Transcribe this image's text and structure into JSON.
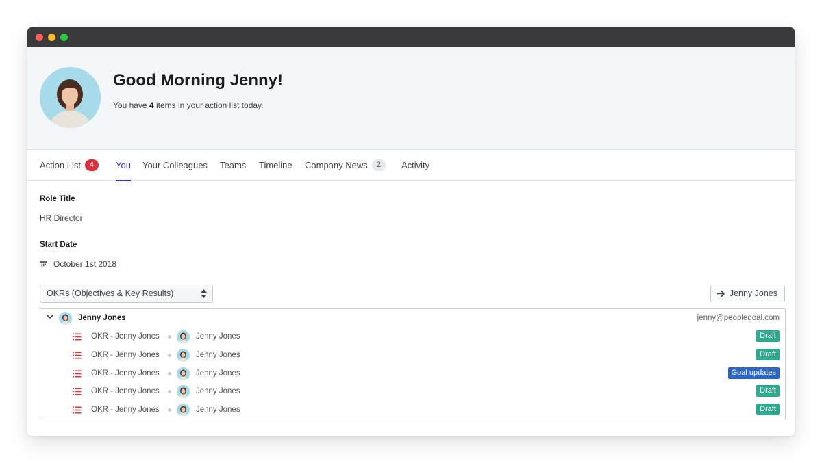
{
  "header": {
    "greeting": "Good Morning Jenny!",
    "subline_prefix": "You have ",
    "subline_count": "4",
    "subline_suffix": " items in your action list today."
  },
  "tabs": [
    {
      "label": "Action List",
      "badge": "4"
    },
    {
      "label": "You"
    },
    {
      "label": "Your Colleagues"
    },
    {
      "label": "Teams"
    },
    {
      "label": "Timeline"
    },
    {
      "label": "Company News",
      "badge": "2"
    },
    {
      "label": "Activity"
    }
  ],
  "active_tab": "You",
  "profile": {
    "role_title_label": "Role Title",
    "role_title_value": "HR Director",
    "start_date_label": "Start Date",
    "start_date_value": "October 1st 2018"
  },
  "view_select": {
    "selected": "OKRs (Objectives & Key Results)"
  },
  "user_button": {
    "label": "Jenny Jones",
    "icon": "arrow-right-icon"
  },
  "tree": {
    "owner_name": "Jenny Jones",
    "owner_email": "jenny@peoplegoal.com",
    "rows": [
      {
        "title": "OKR - Jenny Jones",
        "owner": "Jenny Jones",
        "status": "Draft"
      },
      {
        "title": "OKR - Jenny Jones",
        "owner": "Jenny Jones",
        "status": "Draft"
      },
      {
        "title": "OKR - Jenny Jones",
        "owner": "Jenny Jones",
        "status": "Goal updates"
      },
      {
        "title": "OKR - Jenny Jones",
        "owner": "Jenny Jones",
        "status": "Draft"
      },
      {
        "title": "OKR - Jenny Jones",
        "owner": "Jenny Jones",
        "status": "Draft"
      }
    ]
  },
  "colors": {
    "accent": "#3a34c9",
    "badge_red": "#dc2f3b",
    "draft": "#2eab8f",
    "goal_updates": "#2c66c9",
    "list_icon": "#d63a3a"
  }
}
